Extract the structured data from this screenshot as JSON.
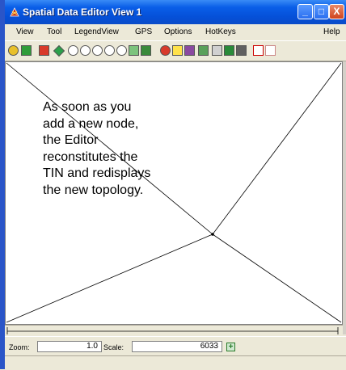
{
  "window": {
    "title": "Spatial Data Editor View 1"
  },
  "titlebar_buttons": {
    "minimize": "_",
    "maximize": "□",
    "close": "X"
  },
  "menu": {
    "items": [
      "View",
      "Tool",
      "LegendView",
      "GPS",
      "Options",
      "HotKeys",
      "Help"
    ]
  },
  "toolbar": {
    "tools": [
      "help-icon",
      "window-icon",
      "add-layer-icon",
      "draw-icon",
      "zoom-fit-icon",
      "zoom-in-icon",
      "zoom-out-icon",
      "zoom-box-icon",
      "zoom-previous-icon",
      "full-extent-icon",
      "select-arrow-icon",
      "find-icon",
      "pointer-icon",
      "color-palette-icon",
      "edit-table-icon",
      "cut-icon",
      "layer-manager-icon",
      "delete-icon",
      "undo-icon",
      "redo-icon"
    ]
  },
  "canvas": {
    "annotation_lines": [
      "As soon as you",
      "add a new node,",
      "the Editor",
      "reconstitutes the",
      "TIN and redisplays",
      "the new topology."
    ]
  },
  "status": {
    "zoom_label": "Zoom:",
    "zoom_value": "1.0",
    "scale_label": "Scale:",
    "scale_value": "6033"
  },
  "colors": {
    "titlebar": "#0550d8",
    "close": "#d0441c",
    "canvas": "#ffffff"
  }
}
